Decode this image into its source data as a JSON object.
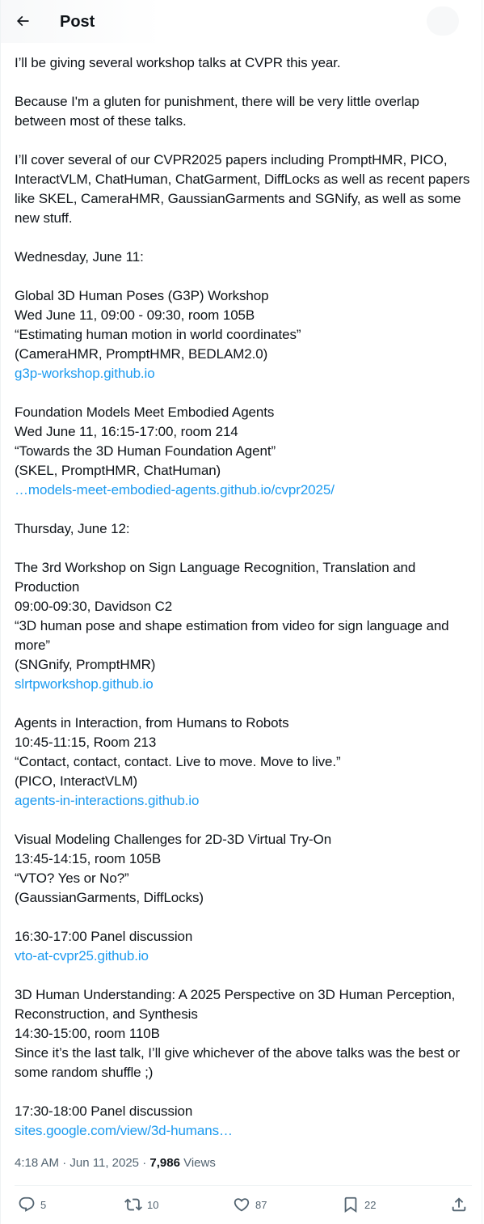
{
  "header": {
    "title": "Post"
  },
  "post": {
    "paragraphs": [
      {
        "lines": [
          {
            "text": "I’ll be giving several workshop talks at CVPR this year."
          }
        ]
      },
      {
        "lines": [
          {
            "text": "Because I'm a gluten for punishment, there will be very little overlap between most of these talks."
          }
        ]
      },
      {
        "lines": [
          {
            "text": "I’ll cover several of our CVPR2025 papers including PromptHMR, PICO, InteractVLM, ChatHuman, ChatGarment, DiffLocks as well as recent papers like SKEL, CameraHMR, GaussianGarments and SGNify, as well as some new stuff."
          }
        ]
      },
      {
        "lines": [
          {
            "text": "Wednesday, June 11:"
          }
        ]
      },
      {
        "lines": [
          {
            "text": "Global 3D Human Poses (G3P) Workshop"
          },
          {
            "text": "Wed June 11, 09:00 - 09:30, room 105B"
          },
          {
            "text": "“Estimating human motion in world coordinates”"
          },
          {
            "text": "(CameraHMR, PromptHMR, BEDLAM2.0)"
          },
          {
            "text": "g3p-workshop.github.io",
            "link": true
          }
        ]
      },
      {
        "lines": [
          {
            "text": "Foundation Models Meet Embodied Agents"
          },
          {
            "text": "Wed June 11, 16:15-17:00, room 214"
          },
          {
            "text": "“Towards the 3D Human Foundation Agent”"
          },
          {
            "text": "(SKEL, PromptHMR, ChatHuman)"
          },
          {
            "text": "…models-meet-embodied-agents.github.io/cvpr2025/",
            "link": true
          }
        ]
      },
      {
        "lines": [
          {
            "text": "Thursday, June 12:"
          }
        ]
      },
      {
        "lines": [
          {
            "text": "The 3rd Workshop on Sign Language Recognition, Translation and Production"
          },
          {
            "text": "09:00-09:30, Davidson C2"
          },
          {
            "text": "“3D human pose and shape estimation from video for sign language and more”"
          },
          {
            "text": "(SNGnify, PromptHMR)"
          },
          {
            "text": "slrtpworkshop.github.io",
            "link": true
          }
        ]
      },
      {
        "lines": [
          {
            "text": "Agents in Interaction, from Humans to Robots"
          },
          {
            "text": "10:45-11:15, Room 213"
          },
          {
            "text": "“Contact, contact, contact. Live to move. Move to live.”"
          },
          {
            "text": "(PICO, InteractVLM)"
          },
          {
            "text": "agents-in-interactions.github.io",
            "link": true
          }
        ]
      },
      {
        "lines": [
          {
            "text": "Visual Modeling Challenges for 2D-3D Virtual Try-On"
          },
          {
            "text": "13:45-14:15, room 105B"
          },
          {
            "text": "“VTO? Yes or No?”"
          },
          {
            "text": "(GaussianGarments, DiffLocks)"
          }
        ]
      },
      {
        "lines": [
          {
            "text": "16:30-17:00 Panel discussion"
          },
          {
            "text": "vto-at-cvpr25.github.io",
            "link": true
          }
        ]
      },
      {
        "lines": [
          {
            "text": "3D Human Understanding: A 2025 Perspective on 3D Human Perception, Reconstruction, and Synthesis"
          },
          {
            "text": "14:30-15:00, room 110B"
          },
          {
            "text": "Since it’s the last talk, I’ll give whichever of the above talks was the best or some random shuffle ;)"
          }
        ]
      },
      {
        "lines": [
          {
            "text": "17:30-18:00 Panel discussion"
          },
          {
            "text": "sites.google.com/view/3d-humans…",
            "link": true
          }
        ]
      }
    ]
  },
  "meta": {
    "time": "4:18 AM",
    "separator": "·",
    "date": "Jun 11, 2025",
    "views_count": "7,986",
    "views_label": "Views"
  },
  "actions": {
    "replies": "5",
    "reposts": "10",
    "likes": "87",
    "bookmarks": "22"
  },
  "icons": {
    "back": "back-arrow-icon",
    "reply": "reply-icon",
    "repost": "repost-icon",
    "like": "heart-icon",
    "bookmark": "bookmark-icon",
    "share": "share-icon"
  },
  "colors": {
    "text": "#0f1419",
    "secondary": "#536471",
    "link": "#1d9bf0",
    "border": "#eff3f4"
  }
}
